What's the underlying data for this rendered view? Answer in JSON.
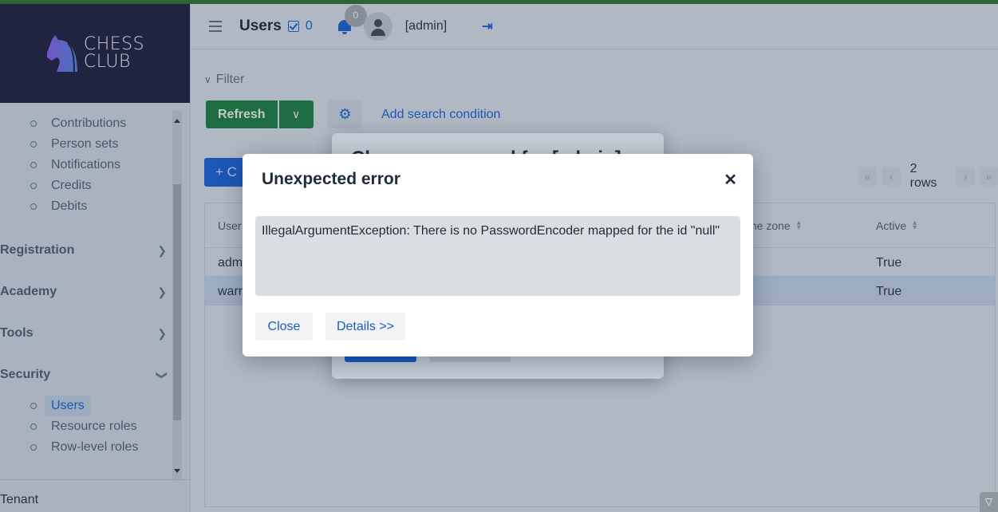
{
  "app": {
    "logo_line1": "CHESS",
    "logo_line2": "CLUB",
    "accent_color": "#1d5bbf",
    "brand_bar_color": "#2d6a2f"
  },
  "header": {
    "menu_icon": "hamburger-icon",
    "title": "Users",
    "selection_count": "0",
    "notifications_count": "0",
    "user": "[admin]",
    "logout_icon": "logout-icon"
  },
  "sidebar": {
    "sub_items_top": [
      {
        "label": "Contributions"
      },
      {
        "label": "Person sets"
      },
      {
        "label": "Notifications"
      },
      {
        "label": "Credits"
      },
      {
        "label": "Debits"
      }
    ],
    "groups": [
      {
        "label": "Registration",
        "expanded": false
      },
      {
        "label": "Academy",
        "expanded": false
      },
      {
        "label": "Tools",
        "expanded": false
      },
      {
        "label": "Security",
        "expanded": true
      }
    ],
    "security_items": [
      {
        "label": "Users",
        "active": true
      },
      {
        "label": "Resource roles",
        "active": false
      },
      {
        "label": "Row-level roles",
        "active": false
      }
    ],
    "footer": "Tenant"
  },
  "filter": {
    "toggle_label": "Filter",
    "refresh_label": "Refresh",
    "add_condition_label": "Add search condition"
  },
  "toolbar": {
    "create_label": "C",
    "rows_label": "2 rows"
  },
  "table": {
    "columns": [
      "User",
      "Time zone",
      "Active"
    ],
    "column_labels_visible": [
      "User",
      "me zone",
      "Active"
    ],
    "rows": [
      {
        "username": "adm",
        "active": "True",
        "selected": false
      },
      {
        "username": "warr",
        "active": "True",
        "selected": true
      }
    ]
  },
  "background_dialog": {
    "title": "Change password for [admin]"
  },
  "error_dialog": {
    "title": "Unexpected error",
    "message": "IllegalArgumentException: There is no PasswordEncoder mapped for the id \"null\"",
    "close_label": "Close",
    "details_label": "Details >>"
  }
}
